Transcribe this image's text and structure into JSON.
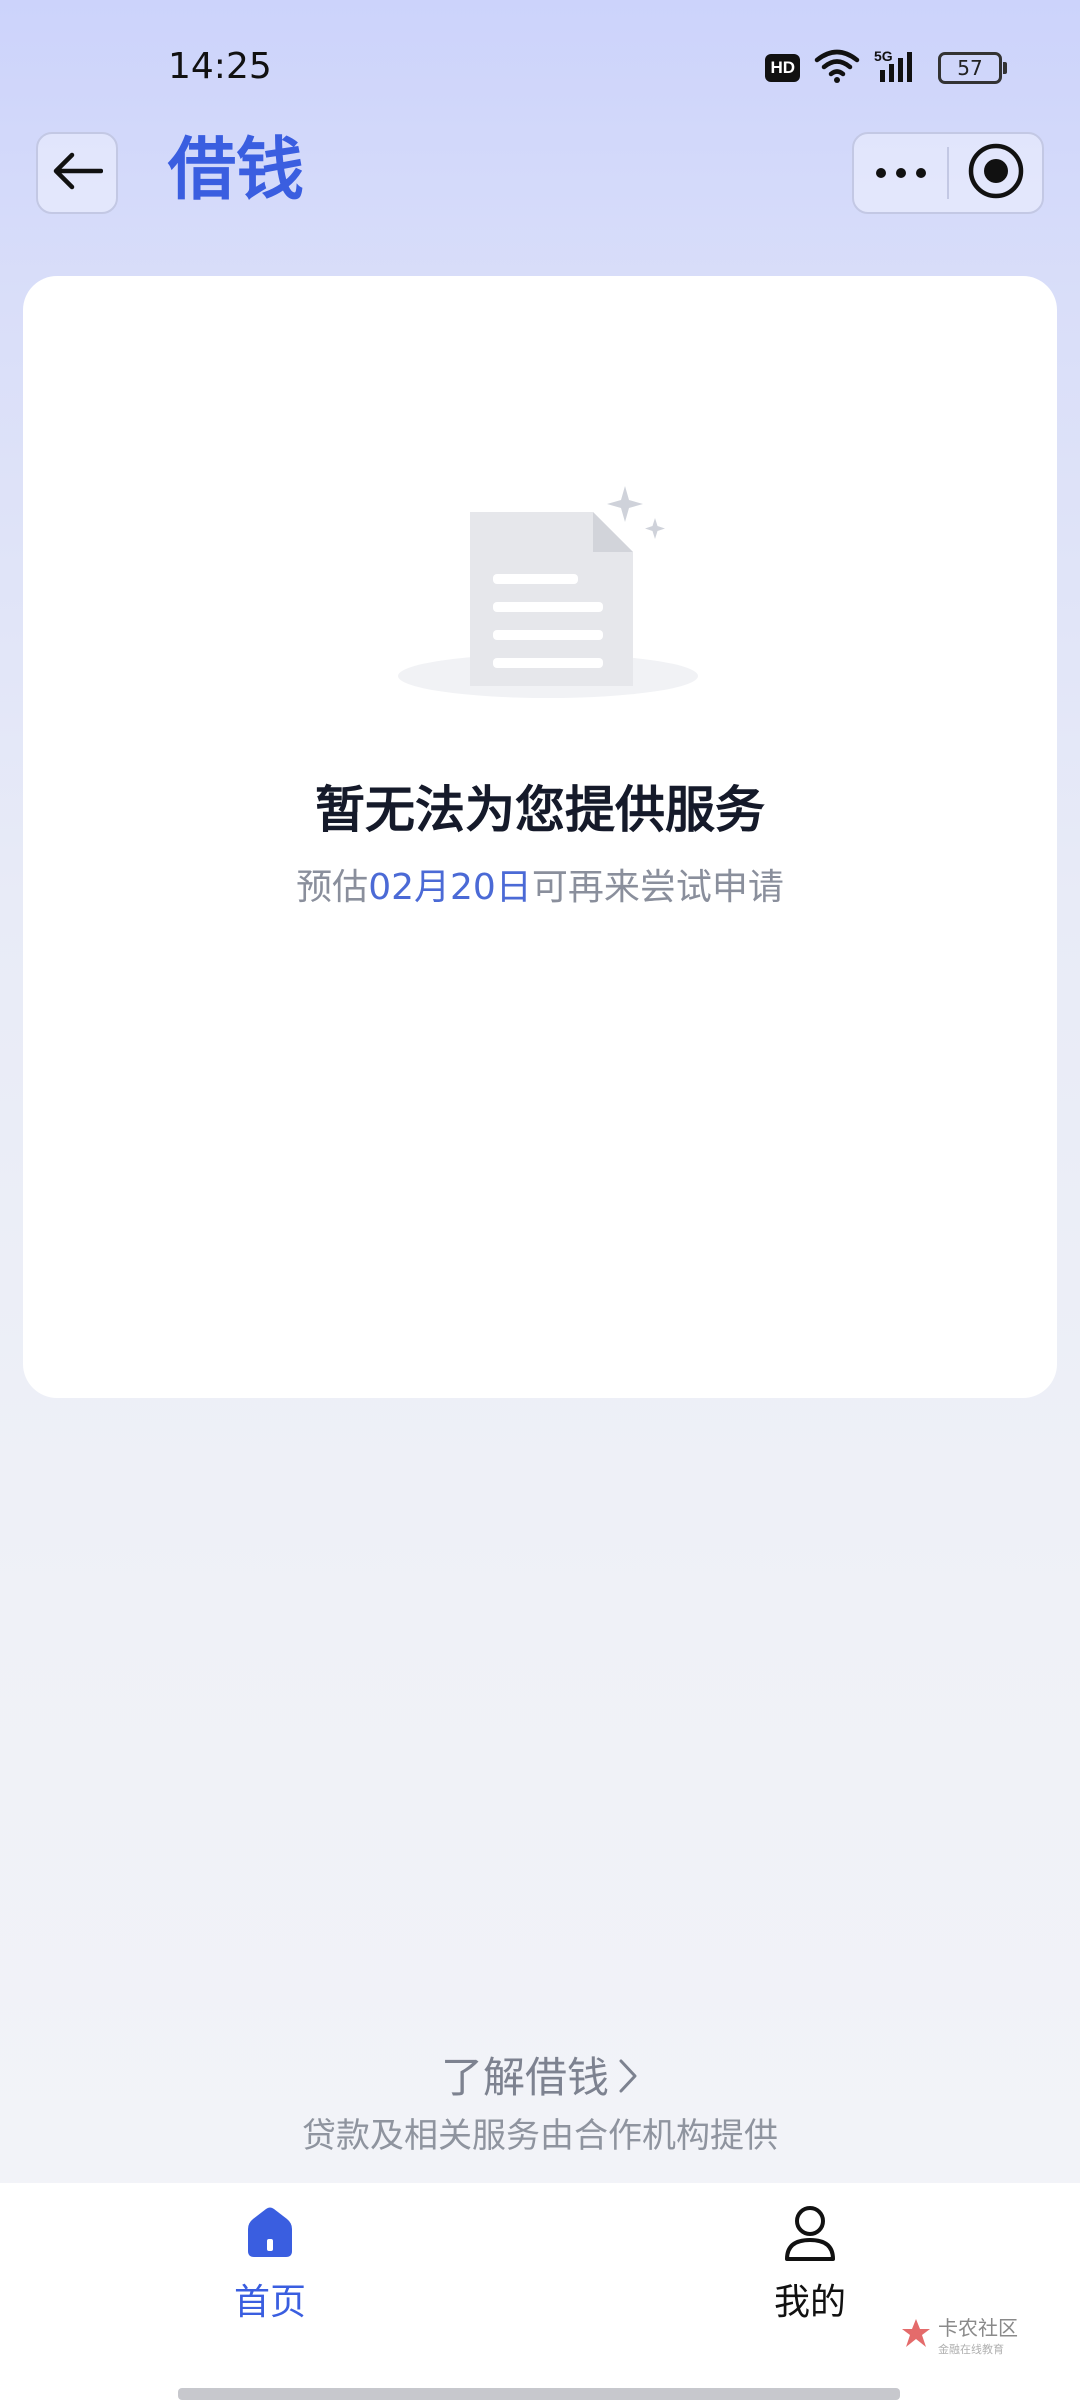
{
  "status_bar": {
    "time": "14:25",
    "hd_badge": "HD",
    "battery_level": "57",
    "network": "5G"
  },
  "header": {
    "title": "借钱",
    "back_icon": "arrow-left-icon",
    "more_icon": "more-dots-icon",
    "close_icon": "target-circle-icon"
  },
  "empty_state": {
    "title": "暂无法为您提供服务",
    "subtitle_prefix": "预估",
    "subtitle_date": "02月20日",
    "subtitle_suffix": "可再来尝试申请"
  },
  "footer": {
    "learn_more": "了解借钱",
    "disclaimer": "贷款及相关服务由合作机构提供"
  },
  "tabs": [
    {
      "label": "首页",
      "icon": "home-icon",
      "active": true
    },
    {
      "label": "我的",
      "icon": "user-icon",
      "active": false
    }
  ],
  "watermark": {
    "main": "卡农社区",
    "sub": "金融在线教育"
  },
  "colors": {
    "accent": "#3a5ee0",
    "date_highlight": "#4b6ad6",
    "title_text": "#151a2a"
  }
}
